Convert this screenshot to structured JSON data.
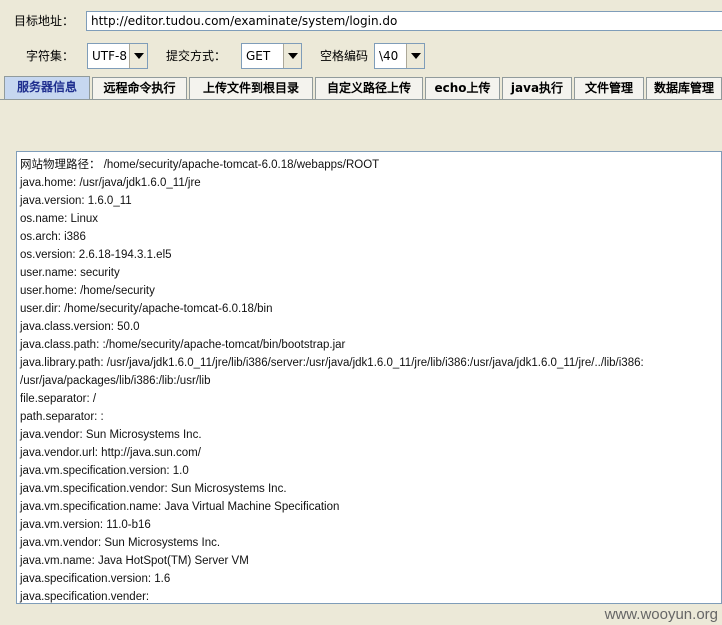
{
  "target": {
    "label": "目标地址：",
    "url": "http://editor.tudou.com/examinate/system/login.do"
  },
  "options": {
    "charset_label": "字符集：",
    "charset_value": "UTF-8",
    "method_label": "提交方式：",
    "method_value": "GET",
    "space_label": "空格编码",
    "space_value": "\\40"
  },
  "tabs": [
    {
      "label": "服务器信息",
      "active": true
    },
    {
      "label": "远程命令执行",
      "active": false
    },
    {
      "label": "上传文件到根目录",
      "active": false
    },
    {
      "label": "自定义路径上传",
      "active": false
    },
    {
      "label": "echo上传",
      "active": false
    },
    {
      "label": "java执行",
      "active": false
    },
    {
      "label": "文件管理",
      "active": false
    },
    {
      "label": "数据库管理",
      "active": false
    }
  ],
  "output_lines": [
    "网站物理路径： /home/security/apache-tomcat-6.0.18/webapps/ROOT",
    "java.home: /usr/java/jdk1.6.0_11/jre",
    "java.version: 1.6.0_11",
    "os.name: Linux",
    "os.arch: i386",
    "os.version: 2.6.18-194.3.1.el5",
    "user.name: security",
    "user.home: /home/security",
    "user.dir: /home/security/apache-tomcat-6.0.18/bin",
    "java.class.version: 50.0",
    "java.class.path: :/home/security/apache-tomcat/bin/bootstrap.jar",
    "java.library.path: /usr/java/jdk1.6.0_11/jre/lib/i386/server:/usr/java/jdk1.6.0_11/jre/lib/i386:/usr/java/jdk1.6.0_11/jre/../lib/i386:",
    "/usr/java/packages/lib/i386:/lib:/usr/lib",
    "file.separator: /",
    "path.separator: :",
    "java.vendor: Sun Microsystems Inc.",
    "java.vendor.url: http://java.sun.com/",
    "java.vm.specification.version: 1.0",
    "java.vm.specification.vendor: Sun Microsystems Inc.",
    "java.vm.specification.name: Java Virtual Machine Specification",
    "java.vm.version: 11.0-b16",
    "java.vm.vendor: Sun Microsystems Inc.",
    "java.vm.name: Java HotSpot(TM) Server VM",
    "java.specification.version: 1.6",
    "java.specification.vender:"
  ],
  "watermark": "www.wooyun.org"
}
